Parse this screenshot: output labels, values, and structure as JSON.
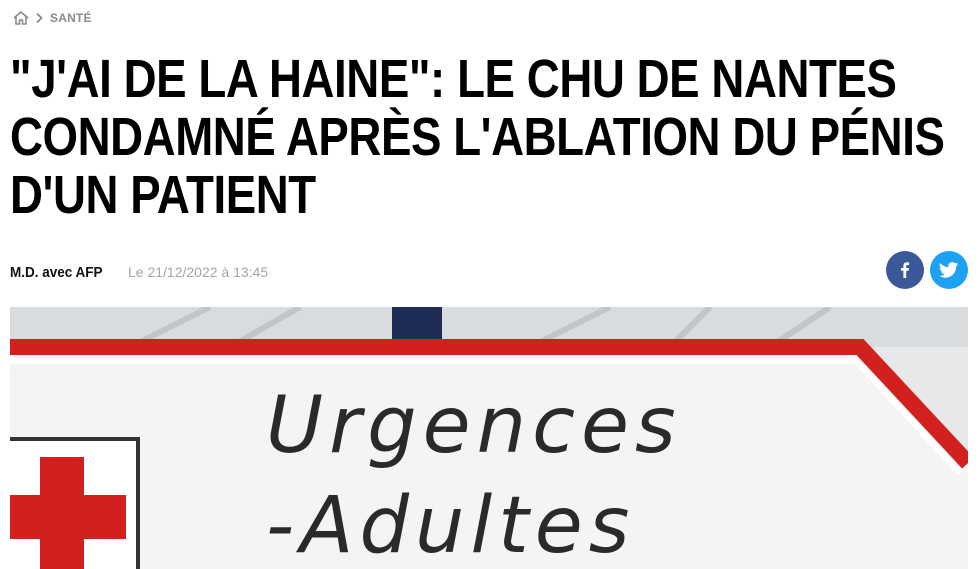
{
  "breadcrumb": {
    "home_icon": "home-icon",
    "separator_icon": "chevron-right-icon",
    "current": "SANTÉ"
  },
  "article": {
    "title": "\"J'AI DE LA HAINE\": LE CHU DE NANTES CONDAMNÉ APRÈS L'ABLATION DU PÉNIS D'UN PATIENT",
    "author": "M.D. avec AFP",
    "date": "Le 21/12/2022 à 13:45"
  },
  "share": {
    "facebook_icon": "facebook-icon",
    "twitter_icon": "twitter-icon",
    "facebook_color": "#3b5998",
    "twitter_color": "#1da1f2"
  },
  "photo": {
    "sign_line1": "Urgences",
    "sign_line2": "-Adultes",
    "sign_border_color": "#d2201f"
  }
}
